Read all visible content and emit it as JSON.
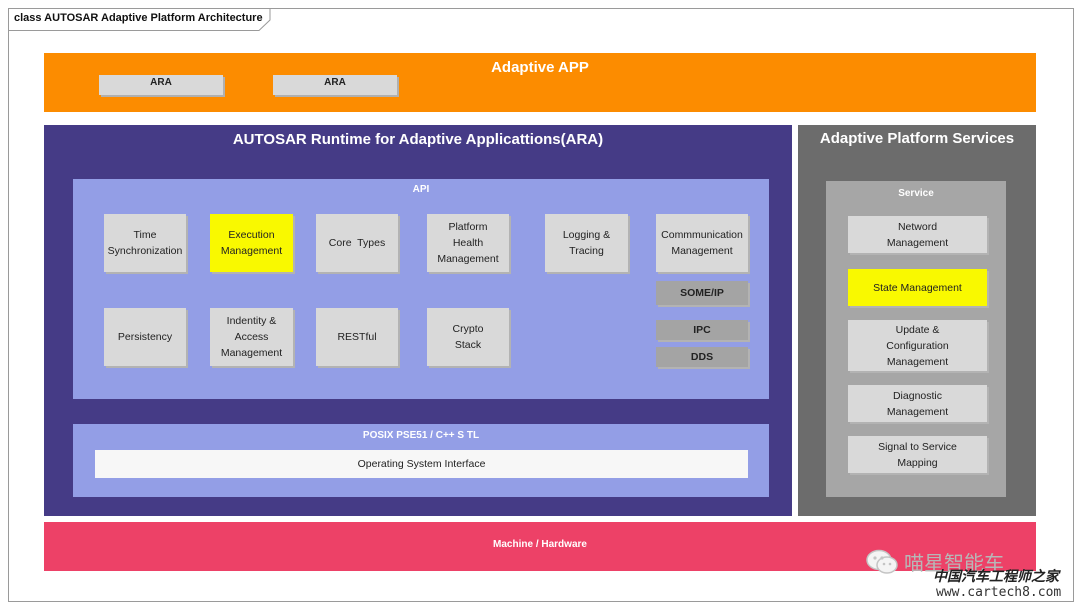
{
  "diagram": {
    "title": "class AUTOSAR Adaptive Platform Architecture",
    "adaptive_app": {
      "title": "Adaptive APP",
      "items": [
        "ARA",
        "ARA"
      ]
    },
    "ara": {
      "title": "AUTOSAR Runtime for Adaptive Applicattions(ARA)",
      "api": {
        "title": "API",
        "modules": {
          "time_sync": "Time\nSynchronization",
          "execution": "Execution\nManagement",
          "core_types": "Core  Types",
          "platform_health": "Platform\nHealth\nManagement",
          "logging": "Logging &\nTracing",
          "communication": "Commmunication\nManagement",
          "some_ip": "SOME/IP",
          "ipc": "IPC",
          "dds": "DDS",
          "persistency": "Persistency",
          "identity": "Indentity &\nAccess\nManagement",
          "restful": "RESTful",
          "crypto": "Crypto\nStack"
        }
      },
      "posix": {
        "title": "POSIX PSE51 / C++ S TL",
        "os_interface": "Operating System Interface"
      }
    },
    "services": {
      "title": "Adaptive Platform Services",
      "inner_title": "Service",
      "items": {
        "network": "Netword\nManagement",
        "state": "State Management",
        "update": "Update &\nConfiguration\nManagement",
        "diagnostic": "Diagnostic\nManagement",
        "signal": "Signal to Service\nMapping"
      }
    },
    "hardware": {
      "title": "Machine / Hardware"
    }
  },
  "watermark": {
    "brand": "喵星智能车",
    "site_name": "中国汽车工程师之家",
    "url": "www.cartech8.com"
  },
  "colors": {
    "adaptive_app": "#fc8c00",
    "ara_panel": "#453b86",
    "api_panel": "#939ee6",
    "module": "#d9d9d9",
    "highlight": "#f9f900",
    "network_module": "#a4a4a4",
    "services_panel": "#6c6c6c",
    "services_inner": "#a6a6a6",
    "hardware": "#ed4167"
  }
}
